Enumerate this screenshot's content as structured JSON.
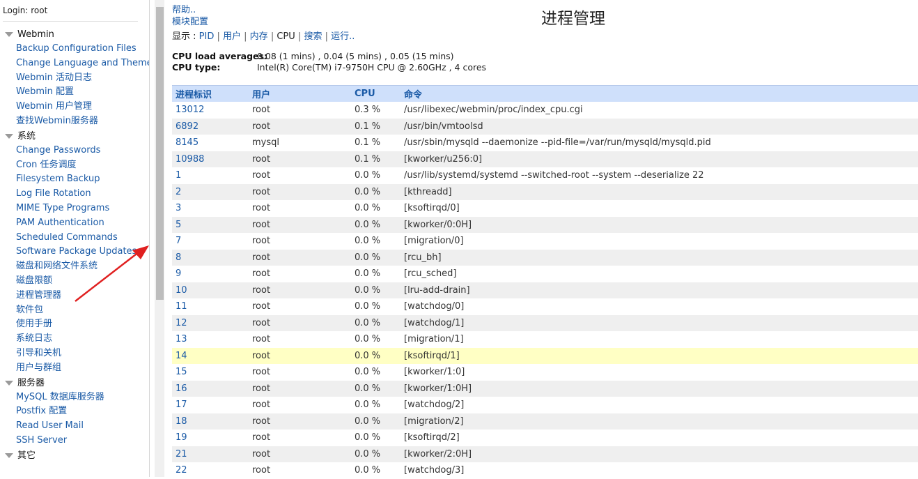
{
  "sidebar": {
    "login": "Login: root",
    "sections": [
      {
        "title": "Webmin",
        "items": [
          "Backup Configuration Files",
          "Change Language and Theme",
          "Webmin 活动日志",
          "Webmin 配置",
          "Webmin 用户管理",
          "查找Webmin服务器"
        ]
      },
      {
        "title": "系统",
        "items": [
          "Change Passwords",
          "Cron 任务调度",
          "Filesystem Backup",
          "Log File Rotation",
          "MIME Type Programs",
          "PAM Authentication",
          "Scheduled Commands",
          "Software Package Updates",
          "磁盘和网络文件系统",
          "磁盘限额",
          "进程管理器",
          "软件包",
          "使用手册",
          "系统日志",
          "引导和关机",
          "用户与群组"
        ]
      },
      {
        "title": "服务器",
        "items": [
          "MySQL 数据库服务器",
          "Postfix 配置",
          "Read User Mail",
          "SSH Server"
        ]
      },
      {
        "title": "其它",
        "items": []
      }
    ]
  },
  "main": {
    "help_link": "帮助..",
    "module_config_link": "模块配置",
    "title": "进程管理",
    "display": {
      "label": "显示 : ",
      "options": [
        {
          "label": "PID",
          "current": false
        },
        {
          "label": "用户",
          "current": false
        },
        {
          "label": "内存",
          "current": false
        },
        {
          "label": "CPU",
          "current": true
        },
        {
          "label": "搜索",
          "current": false
        },
        {
          "label": "运行..",
          "current": false
        }
      ]
    },
    "cpu_load_label": "CPU load averages:",
    "cpu_load_value": "0.08 (1 mins) , 0.04 (5 mins) , 0.05 (15 mins)",
    "cpu_type_label": "CPU type:",
    "cpu_type_value": "Intel(R) Core(TM) i7-9750H CPU @ 2.60GHz , 4 cores"
  },
  "table": {
    "headers": {
      "pid": "进程标识",
      "user": "用户",
      "cpu": "CPU",
      "cmd": "命令"
    },
    "rows": [
      {
        "pid": "13012",
        "user": "root",
        "cpu": "0.3 %",
        "cmd": "/usr/libexec/webmin/proc/index_cpu.cgi"
      },
      {
        "pid": "6892",
        "user": "root",
        "cpu": "0.1 %",
        "cmd": "/usr/bin/vmtoolsd"
      },
      {
        "pid": "8145",
        "user": "mysql",
        "cpu": "0.1 %",
        "cmd": "/usr/sbin/mysqld --daemonize --pid-file=/var/run/mysqld/mysqld.pid"
      },
      {
        "pid": "10988",
        "user": "root",
        "cpu": "0.1 %",
        "cmd": "[kworker/u256:0]"
      },
      {
        "pid": "1",
        "user": "root",
        "cpu": "0.0 %",
        "cmd": "/usr/lib/systemd/systemd --switched-root --system --deserialize 22"
      },
      {
        "pid": "2",
        "user": "root",
        "cpu": "0.0 %",
        "cmd": "[kthreadd]"
      },
      {
        "pid": "3",
        "user": "root",
        "cpu": "0.0 %",
        "cmd": "[ksoftirqd/0]"
      },
      {
        "pid": "5",
        "user": "root",
        "cpu": "0.0 %",
        "cmd": "[kworker/0:0H]"
      },
      {
        "pid": "7",
        "user": "root",
        "cpu": "0.0 %",
        "cmd": "[migration/0]"
      },
      {
        "pid": "8",
        "user": "root",
        "cpu": "0.0 %",
        "cmd": "[rcu_bh]"
      },
      {
        "pid": "9",
        "user": "root",
        "cpu": "0.0 %",
        "cmd": "[rcu_sched]"
      },
      {
        "pid": "10",
        "user": "root",
        "cpu": "0.0 %",
        "cmd": "[lru-add-drain]"
      },
      {
        "pid": "11",
        "user": "root",
        "cpu": "0.0 %",
        "cmd": "[watchdog/0]"
      },
      {
        "pid": "12",
        "user": "root",
        "cpu": "0.0 %",
        "cmd": "[watchdog/1]"
      },
      {
        "pid": "13",
        "user": "root",
        "cpu": "0.0 %",
        "cmd": "[migration/1]"
      },
      {
        "pid": "14",
        "user": "root",
        "cpu": "0.0 %",
        "cmd": "[ksoftirqd/1]",
        "highlight": true
      },
      {
        "pid": "15",
        "user": "root",
        "cpu": "0.0 %",
        "cmd": "[kworker/1:0]"
      },
      {
        "pid": "16",
        "user": "root",
        "cpu": "0.0 %",
        "cmd": "[kworker/1:0H]"
      },
      {
        "pid": "17",
        "user": "root",
        "cpu": "0.0 %",
        "cmd": "[watchdog/2]"
      },
      {
        "pid": "18",
        "user": "root",
        "cpu": "0.0 %",
        "cmd": "[migration/2]"
      },
      {
        "pid": "19",
        "user": "root",
        "cpu": "0.0 %",
        "cmd": "[ksoftirqd/2]"
      },
      {
        "pid": "21",
        "user": "root",
        "cpu": "0.0 %",
        "cmd": "[kworker/2:0H]"
      },
      {
        "pid": "22",
        "user": "root",
        "cpu": "0.0 %",
        "cmd": "[watchdog/3]"
      }
    ]
  },
  "colors": {
    "link": "#1a5aa6",
    "header_bg": "#cfe0fb",
    "row_alt": "#efefef",
    "row_highlight": "#ffffc4",
    "annotation_arrow": "#e02020"
  }
}
